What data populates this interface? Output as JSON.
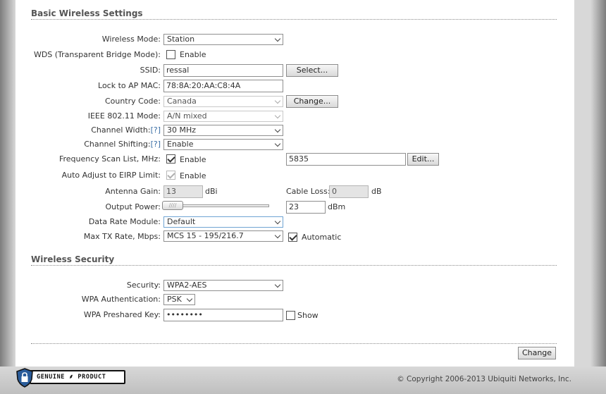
{
  "basic": {
    "title": "Basic Wireless Settings",
    "wireless_mode": {
      "label": "Wireless Mode:",
      "value": "Station"
    },
    "wds": {
      "label": "WDS (Transparent Bridge Mode):",
      "checkbox_label": "Enable",
      "checked": false
    },
    "ssid": {
      "label": "SSID:",
      "value": "ressal",
      "button": "Select..."
    },
    "lock_ap": {
      "label": "Lock to AP MAC:",
      "value": "78:8A:20:AA:C8:4A"
    },
    "country": {
      "label": "Country Code:",
      "value": "Canada",
      "button": "Change..."
    },
    "ieee_mode": {
      "label": "IEEE 802.11 Mode:",
      "value": "A/N mixed"
    },
    "channel_width": {
      "label": "Channel Width:",
      "help": "[?]",
      "value": "30 MHz"
    },
    "channel_shifting": {
      "label": "Channel Shifting:",
      "help": "[?]",
      "value": "Enable"
    },
    "freq_scan": {
      "label": "Frequency Scan List, MHz:",
      "checkbox_label": "Enable",
      "checked": true,
      "value": "5835",
      "button": "Edit..."
    },
    "auto_eirp": {
      "label": "Auto Adjust to EIRP Limit:",
      "checkbox_label": "Enable",
      "checked": true
    },
    "antenna_gain": {
      "label": "Antenna Gain:",
      "value": "13",
      "unit": "dBi"
    },
    "cable_loss": {
      "label": "Cable Loss:",
      "value": "0",
      "unit": "dB"
    },
    "output_power": {
      "label": "Output Power:",
      "value": "23",
      "unit": "dBm",
      "slider_grip": "////"
    },
    "data_rate": {
      "label": "Data Rate Module:",
      "value": "Default"
    },
    "max_tx": {
      "label": "Max TX Rate, Mbps:",
      "value": "MCS 15 - 195/216.7",
      "checkbox_label": "Automatic",
      "checked": true
    }
  },
  "security": {
    "title": "Wireless Security",
    "security": {
      "label": "Security:",
      "value": "WPA2-AES"
    },
    "wpa_auth": {
      "label": "WPA Authentication:",
      "value": "PSK"
    },
    "wpa_key": {
      "label": "WPA Preshared Key:",
      "value": "••••••••",
      "checkbox_label": "Show"
    }
  },
  "actions": {
    "change_button": "Change"
  },
  "footer": {
    "logo_text": "GENUINE ⸙ PRODUCT",
    "copyright": "© Copyright 2006-2013 Ubiquiti Networks, Inc."
  }
}
